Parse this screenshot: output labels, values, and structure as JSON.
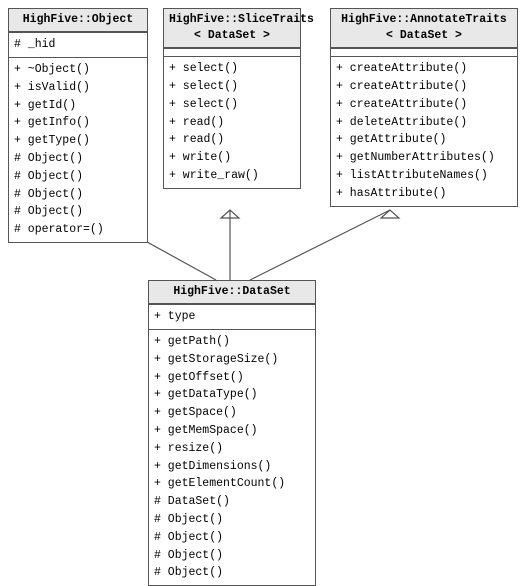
{
  "boxes": {
    "object": {
      "title": "HighFive::Object",
      "section1": [
        "# _hid"
      ],
      "section2": [
        "+ ~Object()",
        "+ isValid()",
        "+ getId()",
        "+ getInfo()",
        "+ getType()",
        "# Object()",
        "# Object()",
        "# Object()",
        "# Object()",
        "# operator=()"
      ]
    },
    "slicetraits": {
      "title_line1": "HighFive::SliceTraits",
      "title_line2": "< DataSet >",
      "section1": [],
      "section2": [
        "+ select()",
        "+ select()",
        "+ select()",
        "+ read()",
        "+ read()",
        "+ write()",
        "+ write_raw()"
      ]
    },
    "annotatetraits": {
      "title_line1": "HighFive::AnnotateTraits",
      "title_line2": "< DataSet >",
      "section1": [],
      "section2": [
        "+ createAttribute()",
        "+ createAttribute()",
        "+ createAttribute()",
        "+ deleteAttribute()",
        "+ getAttribute()",
        "+ getNumberAttributes()",
        "+ listAttributeNames()",
        "+ hasAttribute()"
      ]
    },
    "dataset": {
      "title": "HighFive::DataSet",
      "section1": [
        "+ type"
      ],
      "section2": [
        "+ getPath()",
        "+ getStorageSize()",
        "+ getOffset()",
        "+ getDataType()",
        "+ getSpace()",
        "+ getMemSpace()",
        "+ resize()",
        "+ getDimensions()",
        "+ getElementCount()",
        "# DataSet()",
        "# Object()",
        "# Object()",
        "# Object()",
        "# Object()"
      ]
    }
  },
  "labels": {
    "type_label": "type"
  }
}
